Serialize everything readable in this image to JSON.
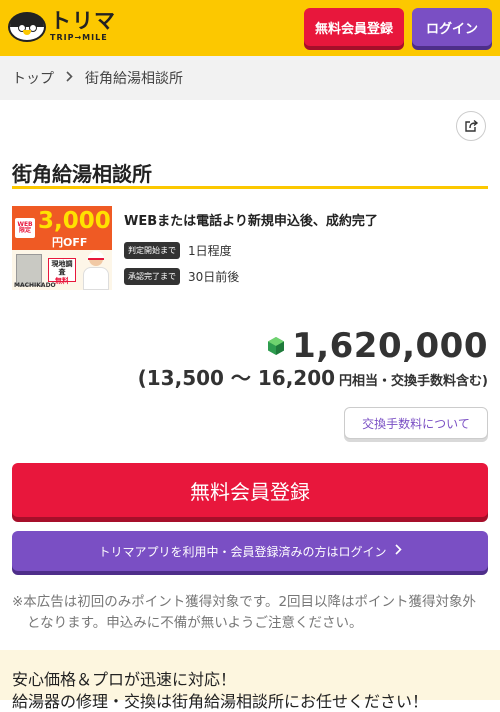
{
  "header": {
    "logo_main": "トリマ",
    "logo_sub": "TRIP→MILE",
    "register_label": "無料会員登録",
    "login_label": "ログイン"
  },
  "breadcrumb": {
    "home": "トップ",
    "current": "街角給湯相談所"
  },
  "page": {
    "title": "街角給湯相談所"
  },
  "banner": {
    "web_tag": "WEB\n限定",
    "amount": "3,000",
    "off": "円OFF",
    "tag_line1": "現地調査",
    "tag_line2": "無料",
    "brand": "MACHIKADO"
  },
  "offer": {
    "condition": "WEBまたは電話より新規申込後、成約完了",
    "rows": [
      {
        "label": "判定開始まで",
        "value": "1日程度"
      },
      {
        "label": "承認完了まで",
        "value": "30日前後"
      }
    ],
    "price": "1,620,000",
    "range": "(13,500 〜 16,200",
    "range_suffix": "円相当・交換手数料含む)",
    "fee_button": "交換手数料について"
  },
  "cta": {
    "register": "無料会員登録",
    "login": "トリマアプリを利用中・会員登録済みの方はログイン"
  },
  "notice": "※本広告は初回のみポイント獲得対象です。2回目以降はポイント獲得対象外となります。申込みに不備が無いようご注意ください。",
  "promo": {
    "line1": "安心価格＆プロが迅速に対応！",
    "line2": "給湯器の修理・交換は街角給湯相談所にお任せください！"
  },
  "colors": {
    "brand_yellow": "#fcc800",
    "register_red": "#e8173c",
    "login_purple": "#7a4fc4"
  },
  "icons": [
    "share-icon",
    "chevron-right-icon",
    "gem-icon"
  ]
}
